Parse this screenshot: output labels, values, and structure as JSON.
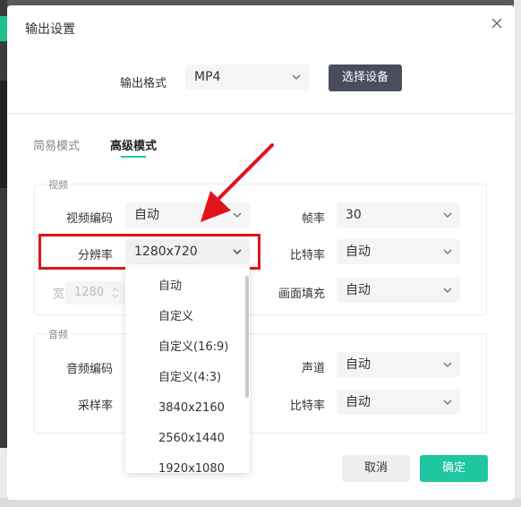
{
  "dialog": {
    "title": "输出设置"
  },
  "format": {
    "label": "输出格式",
    "value": "MP4",
    "device_button": "选择设备"
  },
  "tabs": [
    {
      "label": "简易模式",
      "active": false
    },
    {
      "label": "高级模式",
      "active": true
    }
  ],
  "video": {
    "group_title": "视频",
    "codec_label": "视频编码",
    "codec_value": "自动",
    "fps_label": "帧率",
    "fps_value": "30",
    "resolution_label": "分辨率",
    "resolution_value": "1280x720",
    "bitrate_label": "比特率",
    "bitrate_value": "自动",
    "width_label": "宽",
    "width_value": "1280",
    "fill_label": "画面填充",
    "fill_value": "自动"
  },
  "audio": {
    "group_title": "音频",
    "codec_label": "音频编码",
    "channel_label": "声道",
    "channel_value": "自动",
    "samplerate_label": "采样率",
    "bitrate_label": "比特率",
    "bitrate_value": "自动"
  },
  "resolution_dropdown": {
    "options": [
      "自动",
      "自定义",
      "自定义(16:9)",
      "自定义(4:3)",
      "3840x2160",
      "2560x1440",
      "1920x1080"
    ]
  },
  "buttons": {
    "cancel": "取消",
    "ok": "确定"
  },
  "colors": {
    "accent": "#1ec79f",
    "highlight": "#e0151b",
    "dark_button": "#4a4d5e"
  }
}
